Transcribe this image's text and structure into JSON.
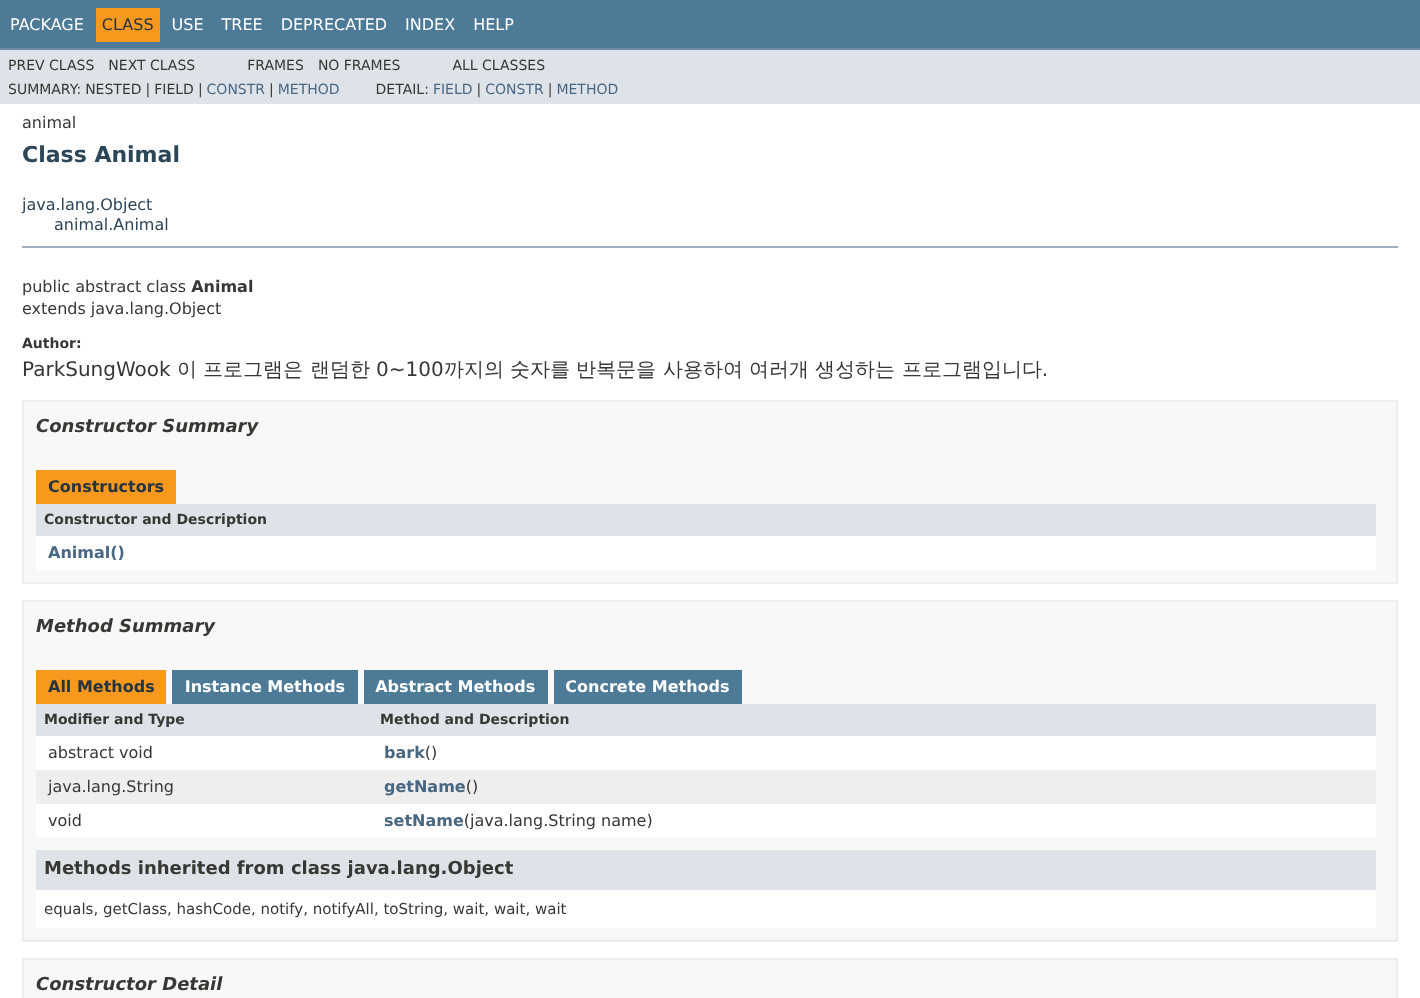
{
  "top_nav": [
    {
      "label": "PACKAGE",
      "selected": false
    },
    {
      "label": "CLASS",
      "selected": true
    },
    {
      "label": "USE",
      "selected": false
    },
    {
      "label": "TREE",
      "selected": false
    },
    {
      "label": "DEPRECATED",
      "selected": false
    },
    {
      "label": "INDEX",
      "selected": false
    },
    {
      "label": "HELP",
      "selected": false
    }
  ],
  "sub_nav": {
    "links": [
      [
        "PREV CLASS",
        "NEXT CLASS"
      ],
      [
        "FRAMES",
        "NO FRAMES"
      ],
      [
        "ALL CLASSES"
      ]
    ],
    "summary": {
      "label": "SUMMARY:",
      "separator": "|",
      "items": [
        {
          "text": "NESTED",
          "link": false
        },
        {
          "text": "FIELD",
          "link": false
        },
        {
          "text": "CONSTR",
          "link": true
        },
        {
          "text": "METHOD",
          "link": true
        }
      ]
    },
    "detail": {
      "label": "DETAIL:",
      "separator": "|",
      "items": [
        {
          "text": "FIELD",
          "link": true
        },
        {
          "text": "CONSTR",
          "link": true
        },
        {
          "text": "METHOD",
          "link": true
        }
      ]
    }
  },
  "package": "animal",
  "title": "Class Animal",
  "inheritance": [
    "java.lang.Object",
    "animal.Animal"
  ],
  "signature": [
    "public abstract class **Animal**",
    "extends java.lang.Object"
  ],
  "author_label": "Author:",
  "author_text": "ParkSungWook 이 프로그램은 랜덤한 0~100까지의 숫자를 반복문을 사용하여 여러개 생성하는 프로그램입니다.",
  "constructor_summary": {
    "title": "Constructor Summary",
    "tabs": [
      {
        "label": "Constructors",
        "selected": true
      }
    ],
    "header": [
      "Constructor and Description"
    ],
    "rows": [
      [
        "Animal()"
      ]
    ]
  },
  "method_summary": {
    "title": "Method Summary",
    "tabs": [
      {
        "label": "All Methods",
        "selected": true
      },
      {
        "label": "Instance Methods",
        "selected": false
      },
      {
        "label": "Abstract Methods",
        "selected": false
      },
      {
        "label": "Concrete Methods",
        "selected": false
      }
    ],
    "header": [
      "Modifier and Type",
      "Method and Description"
    ],
    "rows": [
      {
        "type": "abstract void",
        "name": "bark",
        "params": "()"
      },
      {
        "type": "java.lang.String",
        "name": "getName",
        "params": "()"
      },
      {
        "type": "void",
        "name": "setName",
        "params": "(java.lang.String name)"
      }
    ],
    "inherited_title": "Methods inherited from class java.lang.Object",
    "inherited_list": "equals, getClass, hashCode, notify, notifyAll, toString, wait, wait, wait"
  },
  "constructor_detail": {
    "title": "Constructor Detail"
  }
}
